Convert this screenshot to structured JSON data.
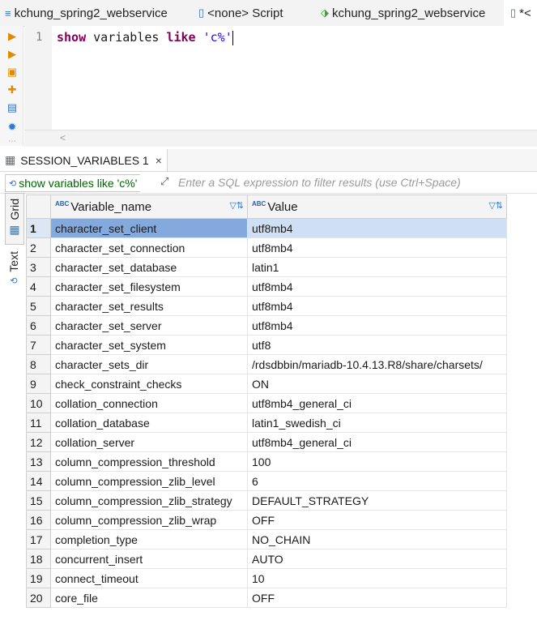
{
  "tabs": [
    {
      "label": "kchung_spring2_webservice",
      "icon": "sql-editor-icon",
      "active": false
    },
    {
      "label": "<none> Script",
      "icon": "script-icon",
      "active": false
    },
    {
      "label": "kchung_spring2_webservice",
      "icon": "connection-icon",
      "active": false
    },
    {
      "label": "*<",
      "icon": "script-icon",
      "active": true
    }
  ],
  "left_rail": [
    "execute-icon",
    "execute-statement-icon",
    "execute-script-icon",
    "explain-plan-icon",
    "load-script-icon",
    "settings-icon"
  ],
  "editor": {
    "line_number": "1",
    "code": {
      "keyword1": "show",
      "text1": " variables ",
      "keyword2": "like",
      "space": " ",
      "string": "'c%'"
    }
  },
  "result_tab": {
    "label": "SESSION_VARIABLES 1",
    "close": "×"
  },
  "filter": {
    "query_label": "show variables like 'c%'",
    "placeholder": "Enter a SQL expression to filter results (use Ctrl+Space)"
  },
  "side_buttons": {
    "grid": "Grid",
    "text": "Text"
  },
  "grid": {
    "columns": [
      {
        "label": "Variable_name",
        "type_badge": "ABC"
      },
      {
        "label": "Value",
        "type_badge": "ABC"
      }
    ],
    "rows": [
      {
        "num": "1",
        "name": "character_set_client",
        "value": "utf8mb4"
      },
      {
        "num": "2",
        "name": "character_set_connection",
        "value": "utf8mb4"
      },
      {
        "num": "3",
        "name": "character_set_database",
        "value": "latin1"
      },
      {
        "num": "4",
        "name": "character_set_filesystem",
        "value": "utf8mb4"
      },
      {
        "num": "5",
        "name": "character_set_results",
        "value": "utf8mb4"
      },
      {
        "num": "6",
        "name": "character_set_server",
        "value": "utf8mb4"
      },
      {
        "num": "7",
        "name": "character_set_system",
        "value": "utf8"
      },
      {
        "num": "8",
        "name": "character_sets_dir",
        "value": "/rdsdbbin/mariadb-10.4.13.R8/share/charsets/"
      },
      {
        "num": "9",
        "name": "check_constraint_checks",
        "value": "ON"
      },
      {
        "num": "10",
        "name": "collation_connection",
        "value": "utf8mb4_general_ci"
      },
      {
        "num": "11",
        "name": "collation_database",
        "value": "latin1_swedish_ci"
      },
      {
        "num": "12",
        "name": "collation_server",
        "value": "utf8mb4_general_ci"
      },
      {
        "num": "13",
        "name": "column_compression_threshold",
        "value": "100"
      },
      {
        "num": "14",
        "name": "column_compression_zlib_level",
        "value": "6"
      },
      {
        "num": "15",
        "name": "column_compression_zlib_strategy",
        "value": "DEFAULT_STRATEGY"
      },
      {
        "num": "16",
        "name": "column_compression_zlib_wrap",
        "value": "OFF"
      },
      {
        "num": "17",
        "name": "completion_type",
        "value": "NO_CHAIN"
      },
      {
        "num": "18",
        "name": "concurrent_insert",
        "value": "AUTO"
      },
      {
        "num": "19",
        "name": "connect_timeout",
        "value": "10"
      },
      {
        "num": "20",
        "name": "core_file",
        "value": "OFF"
      }
    ]
  }
}
